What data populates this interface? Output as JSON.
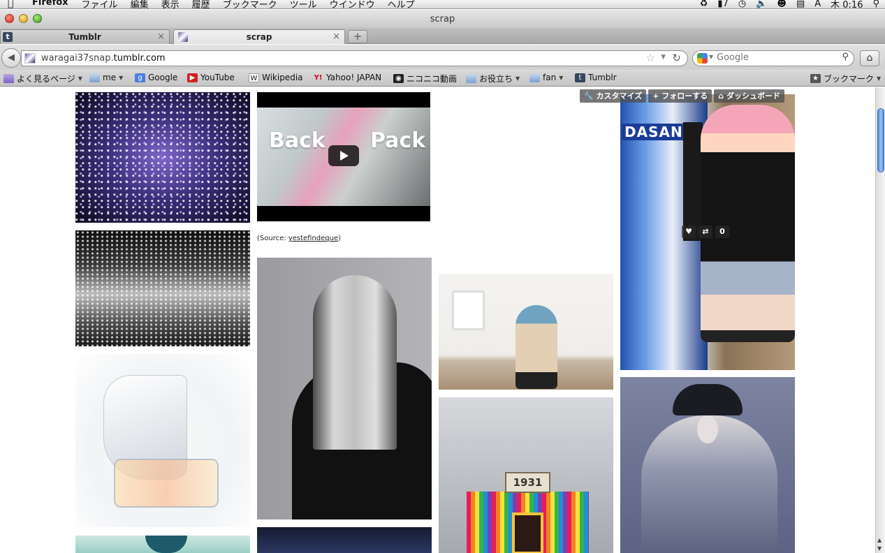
{
  "menubar": {
    "app_name": "Firefox",
    "menus": [
      "ファイル",
      "編集",
      "表示",
      "履歴",
      "ブックマーク",
      "ツール",
      "ウインドウ",
      "ヘルプ"
    ],
    "status": {
      "input_mode": "A",
      "battery": "7",
      "clock": "木 0:16"
    }
  },
  "window": {
    "title": "scrap"
  },
  "tabs": [
    {
      "label": "Tumblr",
      "favicon": "t"
    },
    {
      "label": "scrap"
    }
  ],
  "newtab": "+",
  "navbar": {
    "url_host_prefix": "waragai37snap.",
    "url_host_main": "tumblr.com",
    "search_placeholder": "Google"
  },
  "bookmarks": [
    {
      "label": "よく見るページ",
      "icon": "smart-folder",
      "dropdown": true
    },
    {
      "label": "me",
      "icon": "folder",
      "dropdown": true
    },
    {
      "label": "Google",
      "icon": "google"
    },
    {
      "label": "YouTube",
      "icon": "youtube"
    },
    {
      "label": "Wikipedia",
      "icon": "wikipedia"
    },
    {
      "label": "Yahoo! JAPAN",
      "icon": "yahoo"
    },
    {
      "label": "ニコニコ動画",
      "icon": "niconico"
    },
    {
      "label": "お役立ち",
      "icon": "folder",
      "dropdown": true
    },
    {
      "label": "fan",
      "icon": "folder",
      "dropdown": true
    },
    {
      "label": "Tumblr",
      "icon": "tumblr"
    },
    {
      "label": "ブックマーク",
      "icon": "bookmarks-menu",
      "dropdown": true
    }
  ],
  "tumblr_controls": {
    "customize": "カスタマイズ",
    "follow": "フォローする",
    "dashboard": "ダッシュボード"
  },
  "video_post": {
    "title_left": "Back",
    "title_right": "Pack",
    "caption_prefix": "(Source: ",
    "caption_link": "yestefindeque",
    "caption_suffix": ")"
  },
  "tunnel_sign": "1931",
  "vending_logo": "DASANI",
  "post_actions": {
    "like_count": "0"
  },
  "colors": {
    "link": "#222222",
    "scroll_thumb": "#4b8ad8",
    "tumblr_navy": "#36465d"
  }
}
